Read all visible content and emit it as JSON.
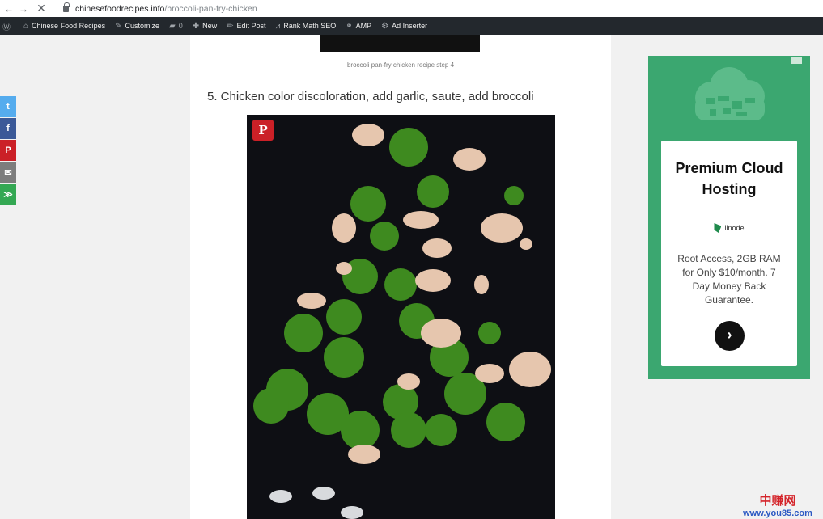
{
  "browser": {
    "url_host": "chinesefoodrecipes.info",
    "url_path": "/broccoli-pan-fry-chicken",
    "icons": [
      "back-arrow-icon",
      "forward-arrow-icon",
      "stop-icon",
      "lock-icon"
    ]
  },
  "adminbar": {
    "items": [
      {
        "icon": "wordpress-icon",
        "label": ""
      },
      {
        "icon": "home-icon",
        "label": "Chinese Food Recipes"
      },
      {
        "icon": "brush-icon",
        "label": "Customize"
      },
      {
        "icon": "comment-icon",
        "label": "0"
      },
      {
        "icon": "plus-icon",
        "label": "New"
      },
      {
        "icon": "pencil-icon",
        "label": "Edit Post"
      },
      {
        "icon": "rankmath-icon",
        "label": "Rank Math SEO"
      },
      {
        "icon": "link-icon",
        "label": "AMP"
      },
      {
        "icon": "gear-icon",
        "label": "Ad Inserter"
      }
    ]
  },
  "article": {
    "prev_caption": "broccoli pan-fry chicken recipe step 4",
    "step_heading": "5. Chicken color discoloration, add garlic, saute, add broccoli",
    "pin_label": "P"
  },
  "social": [
    {
      "icon": "twitter-icon",
      "label": "t",
      "color": "#55acee"
    },
    {
      "icon": "facebook-icon",
      "label": "f",
      "color": "#3b5998"
    },
    {
      "icon": "pinterest-icon",
      "label": "P",
      "color": "#cb2027"
    },
    {
      "icon": "email-icon",
      "label": "✉",
      "color": "#7d7d7d"
    },
    {
      "icon": "share-icon",
      "label": "≫",
      "color": "#34a853"
    }
  ],
  "ad": {
    "title": "Premium Cloud Hosting",
    "brand": "linode",
    "description": "Root Access, 2GB RAM for Only $10/month. 7 Day Money Back Guarantee.",
    "cta_icon": "chevron-right-icon",
    "bg_color": "#3ba770"
  },
  "watermark": {
    "cn": "中赚网",
    "en": "www.you85.com"
  }
}
